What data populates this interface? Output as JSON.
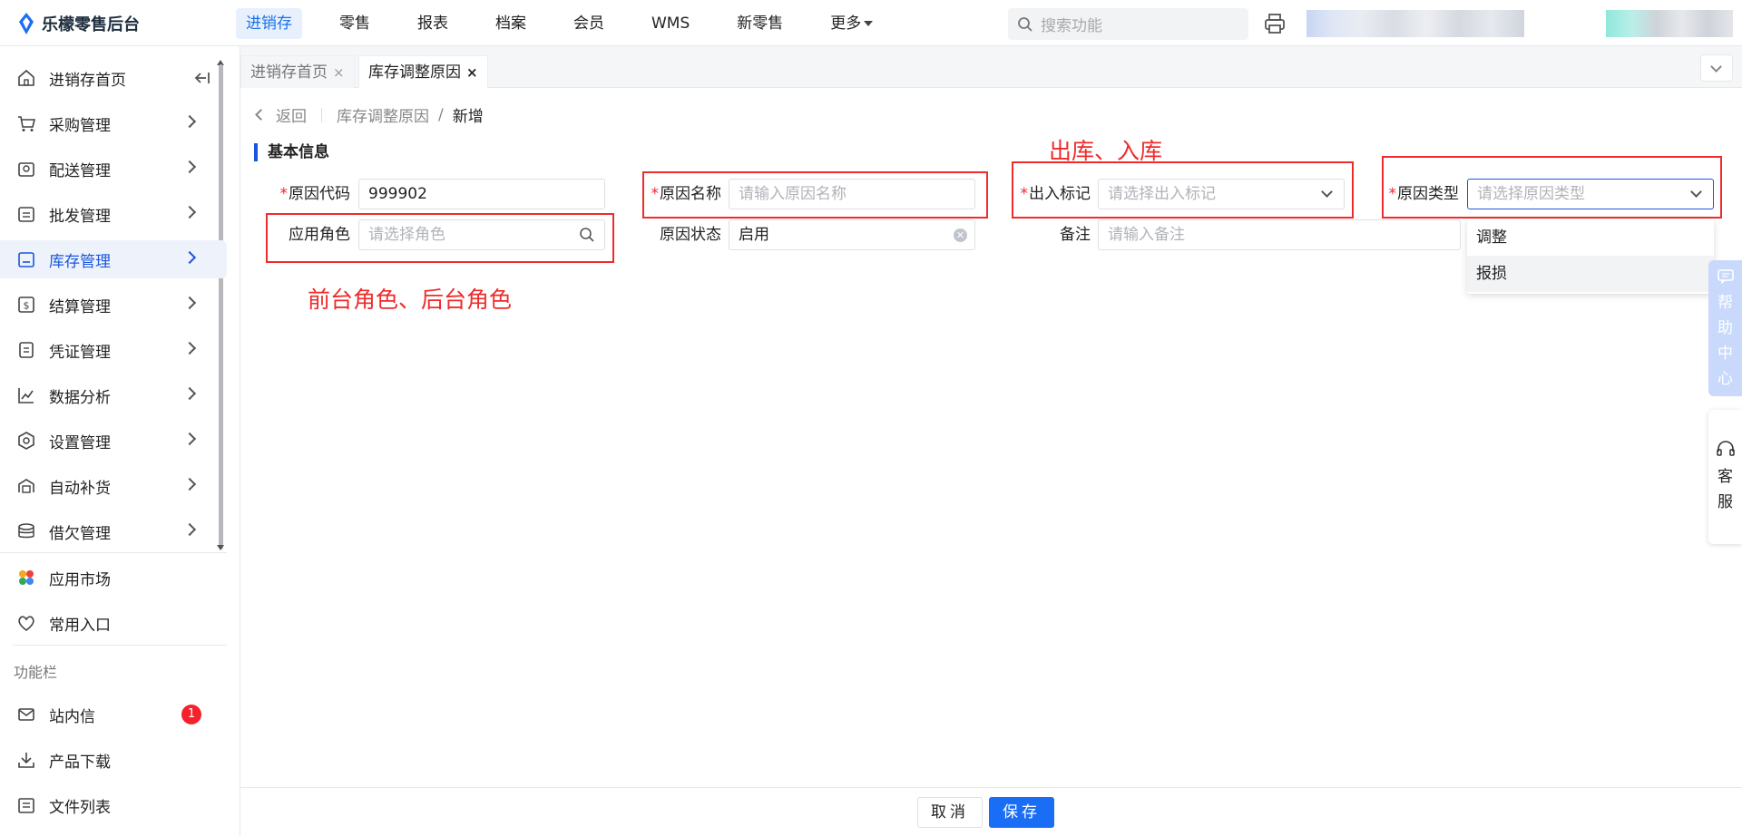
{
  "app": {
    "logo_text": "乐檬零售后台"
  },
  "topnav": {
    "items": [
      "进销存",
      "零售",
      "报表",
      "档案",
      "会员",
      "WMS",
      "新零售",
      "更多"
    ],
    "active_index": 0
  },
  "search": {
    "placeholder": "搜索功能"
  },
  "sidebar": {
    "items": [
      {
        "label": "进销存首页",
        "icon": "home-icon"
      },
      {
        "label": "采购管理",
        "icon": "cart-icon"
      },
      {
        "label": "配送管理",
        "icon": "delivery-icon"
      },
      {
        "label": "批发管理",
        "icon": "wholesale-icon"
      },
      {
        "label": "库存管理",
        "icon": "inventory-icon"
      },
      {
        "label": "结算管理",
        "icon": "settlement-icon"
      },
      {
        "label": "凭证管理",
        "icon": "voucher-icon"
      },
      {
        "label": "数据分析",
        "icon": "chart-icon"
      },
      {
        "label": "设置管理",
        "icon": "settings-icon"
      },
      {
        "label": "自动补货",
        "icon": "replenish-icon"
      },
      {
        "label": "借欠管理",
        "icon": "coins-icon"
      }
    ],
    "active_label": "库存管理",
    "extra": [
      {
        "label": "应用市场",
        "icon": "app-market-icon"
      },
      {
        "label": "常用入口",
        "icon": "heart-icon"
      }
    ],
    "section_title": "功能栏",
    "tools": [
      {
        "label": "站内信",
        "icon": "mail-icon",
        "badge": "1"
      },
      {
        "label": "产品下载",
        "icon": "download-icon"
      },
      {
        "label": "文件列表",
        "icon": "file-list-icon"
      }
    ]
  },
  "tabs": [
    {
      "label": "进销存首页",
      "close": "×"
    },
    {
      "label": "库存调整原因",
      "close": "×"
    }
  ],
  "breadcrumb": {
    "back": "返回",
    "parent": "库存调整原因",
    "sep": "/",
    "current": "新增"
  },
  "section": {
    "title": "基本信息"
  },
  "form": {
    "reason_code": {
      "label": "原因代码",
      "value": "999902"
    },
    "reason_name": {
      "label": "原因名称",
      "placeholder": "请输入原因名称"
    },
    "in_out_flag": {
      "label": "出入标记",
      "placeholder": "请选择出入标记"
    },
    "reason_type": {
      "label": "原因类型",
      "placeholder": "请选择原因类型"
    },
    "apply_role": {
      "label": "应用角色",
      "placeholder": "请选择角色"
    },
    "reason_status": {
      "label": "原因状态",
      "value": "启用"
    },
    "remark": {
      "label": "备注",
      "placeholder": "请输入备注"
    },
    "required_mark": "*"
  },
  "reason_type_options": [
    "调整",
    "报损"
  ],
  "annotations": {
    "in_out": "出库、入库",
    "role": "前台角色、后台角色"
  },
  "float": {
    "help": [
      "帮",
      "助",
      "中",
      "心"
    ],
    "service": [
      "客",
      "服"
    ]
  },
  "footer": {
    "cancel": "取消",
    "save": "保存"
  },
  "colors": {
    "primary": "#1a56db",
    "annotation": "#ef2b2b",
    "badge": "#f5222d"
  }
}
